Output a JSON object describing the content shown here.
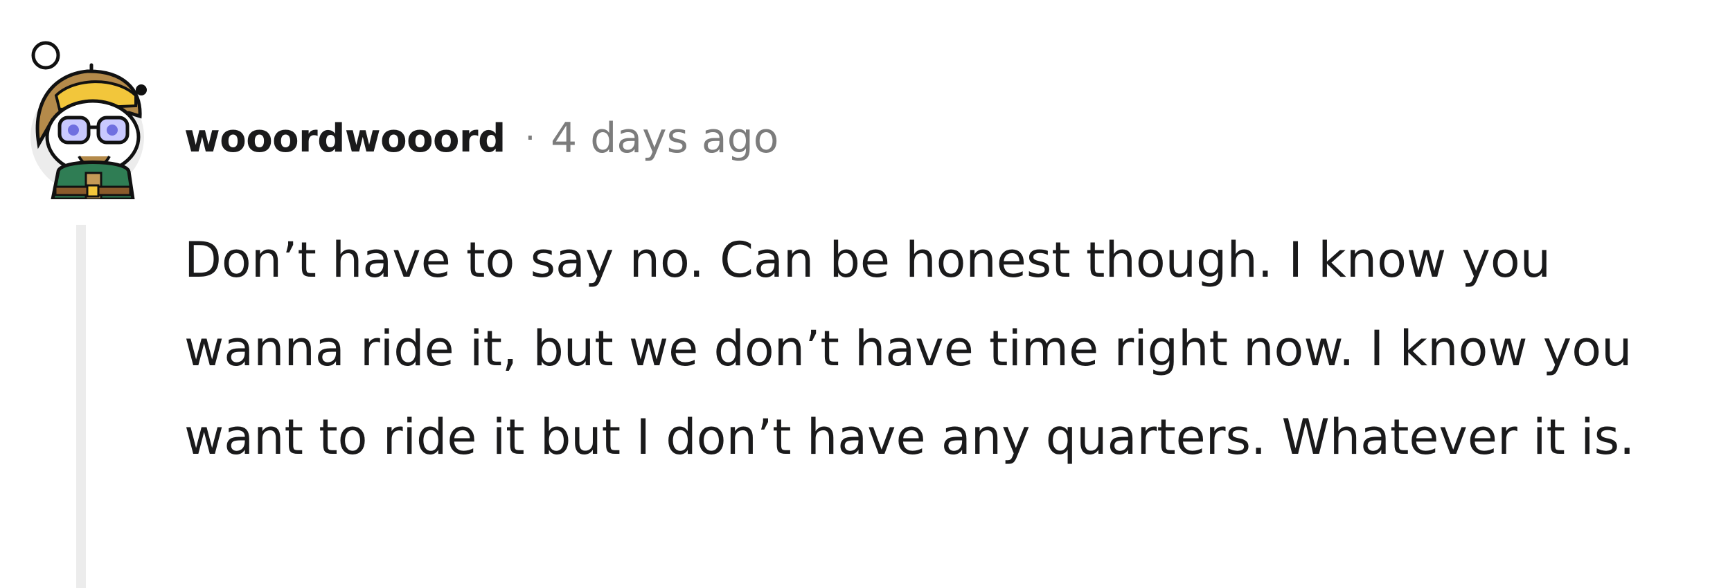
{
  "comment": {
    "username": "wooordwooord",
    "separator": "·",
    "timestamp": "4 days ago",
    "body": "Don’t have to say no. Can be honest though. I know you wanna ride it, but we don’t have time right now. I know you want to ride it but I don’t have any quarters. Whatever it is.",
    "avatar_icon": "snoo-avatar-icon"
  },
  "colors": {
    "background": "#ffffff",
    "text": "#1a1a1b",
    "meta": "#7c7c7c",
    "thread_line": "#ececec"
  }
}
